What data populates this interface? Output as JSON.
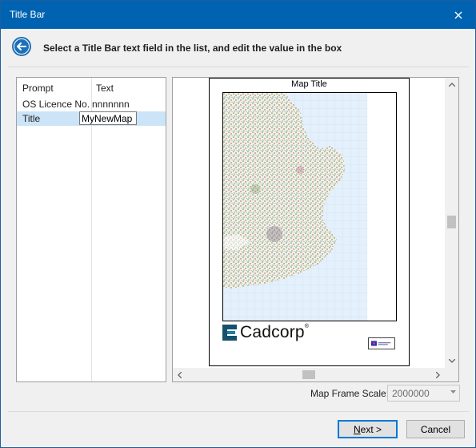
{
  "window": {
    "title": "Title Bar"
  },
  "header": {
    "instruction": "Select a Title Bar text field in the list, and edit the value in the box"
  },
  "list": {
    "columns": [
      "Prompt",
      "Text"
    ],
    "rows": [
      {
        "prompt": "OS Licence No.",
        "text": "nnnnnnn"
      },
      {
        "prompt": "Title",
        "text": ""
      }
    ],
    "edit_value": "MyNewMap"
  },
  "preview": {
    "map_title": "Map Title",
    "logo_text": "Cadcorp",
    "logo_mark": "®"
  },
  "scale": {
    "label": "Map Frame Scale:",
    "value": "2000000"
  },
  "buttons": {
    "next_first": "N",
    "next_rest": "ext >",
    "cancel": "Cancel"
  },
  "colors": {
    "titlebar": "#0063b1",
    "accent": "#0078d7",
    "selection": "#cce4f7"
  },
  "icons": {
    "back": "back-arrow-icon",
    "close": "close-icon"
  }
}
